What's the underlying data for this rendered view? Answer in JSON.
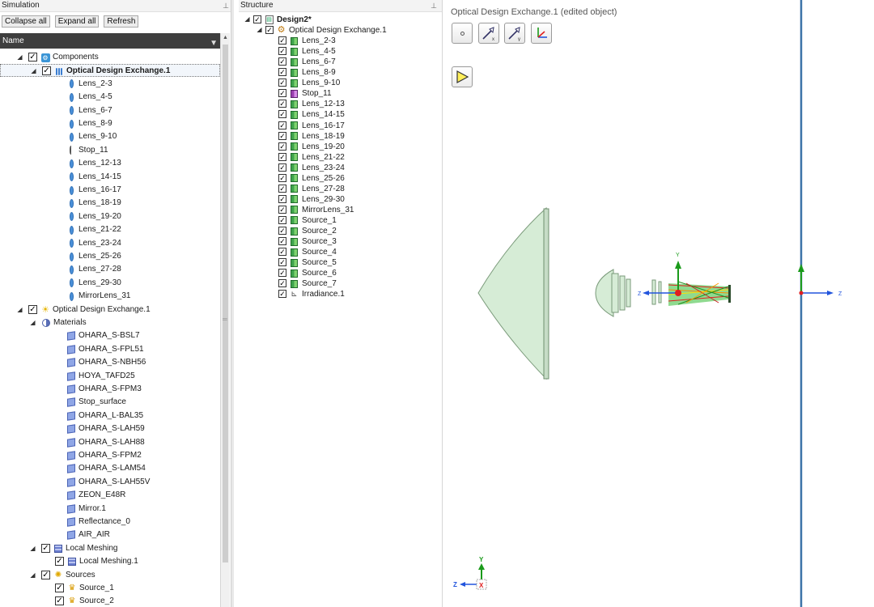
{
  "simulation": {
    "title": "Simulation",
    "toolbar": {
      "collapse_all": "Collapse all",
      "expand_all": "Expand all",
      "refresh": "Refresh"
    },
    "column_header": "Name",
    "tree": [
      {
        "label": "Components",
        "icon": "components-icon",
        "level": 0,
        "expander": "open",
        "checkbox": true
      },
      {
        "label": "Optical Design Exchange.1",
        "icon": "optical-design-exchange-icon",
        "level": 1,
        "expander": "open",
        "checkbox": true,
        "selected": true
      },
      {
        "label": "Lens_2-3",
        "icon": "lens-icon",
        "level": 2
      },
      {
        "label": "Lens_4-5",
        "icon": "lens-icon",
        "level": 2
      },
      {
        "label": "Lens_6-7",
        "icon": "lens-icon",
        "level": 2
      },
      {
        "label": "Lens_8-9",
        "icon": "lens-icon",
        "level": 2
      },
      {
        "label": "Lens_9-10",
        "icon": "lens-icon",
        "level": 2
      },
      {
        "label": "Stop_11",
        "icon": "stop-icon",
        "level": 2
      },
      {
        "label": "Lens_12-13",
        "icon": "lens-icon",
        "level": 2
      },
      {
        "label": "Lens_14-15",
        "icon": "lens-icon",
        "level": 2
      },
      {
        "label": "Lens_16-17",
        "icon": "lens-icon",
        "level": 2
      },
      {
        "label": "Lens_18-19",
        "icon": "lens-icon",
        "level": 2
      },
      {
        "label": "Lens_19-20",
        "icon": "lens-icon",
        "level": 2
      },
      {
        "label": "Lens_21-22",
        "icon": "lens-icon",
        "level": 2
      },
      {
        "label": "Lens_23-24",
        "icon": "lens-icon",
        "level": 2
      },
      {
        "label": "Lens_25-26",
        "icon": "lens-icon",
        "level": 2
      },
      {
        "label": "Lens_27-28",
        "icon": "lens-icon",
        "level": 2
      },
      {
        "label": "Lens_29-30",
        "icon": "lens-icon",
        "level": 2
      },
      {
        "label": "MirrorLens_31",
        "icon": "lens-icon",
        "level": 2
      },
      {
        "label": "Optical Design Exchange.1",
        "icon": "sun-icon",
        "level": 0,
        "expander": "open",
        "checkbox": true
      },
      {
        "label": "Materials",
        "icon": "materials-icon",
        "level": 1,
        "expander": "open"
      },
      {
        "label": "OHARA_S-BSL7",
        "icon": "material-icon",
        "level": 2
      },
      {
        "label": "OHARA_S-FPL51",
        "icon": "material-icon",
        "level": 2
      },
      {
        "label": "OHARA_S-NBH56",
        "icon": "material-icon",
        "level": 2
      },
      {
        "label": "HOYA_TAFD25",
        "icon": "material-icon",
        "level": 2
      },
      {
        "label": "OHARA_S-FPM3",
        "icon": "material-icon",
        "level": 2
      },
      {
        "label": "Stop_surface",
        "icon": "material-icon",
        "level": 2
      },
      {
        "label": "OHARA_L-BAL35",
        "icon": "material-icon",
        "level": 2
      },
      {
        "label": "OHARA_S-LAH59",
        "icon": "material-icon",
        "level": 2
      },
      {
        "label": "OHARA_S-LAH88",
        "icon": "material-icon",
        "level": 2
      },
      {
        "label": "OHARA_S-FPM2",
        "icon": "material-icon",
        "level": 2
      },
      {
        "label": "OHARA_S-LAM54",
        "icon": "material-icon",
        "level": 2
      },
      {
        "label": "OHARA_S-LAH55V",
        "icon": "material-icon",
        "level": 2
      },
      {
        "label": "ZEON_E48R",
        "icon": "material-icon",
        "level": 2
      },
      {
        "label": "Mirror.1",
        "icon": "material-icon",
        "level": 2
      },
      {
        "label": "Reflectance_0",
        "icon": "material-icon",
        "level": 2
      },
      {
        "label": "AIR_AIR",
        "icon": "material-icon",
        "level": 2
      },
      {
        "label": "Local Meshing",
        "icon": "local-meshing-icon",
        "level": 1,
        "expander": "open",
        "checkbox": true
      },
      {
        "label": "Local Meshing.1",
        "icon": "mesh-icon",
        "level": 2,
        "checkbox": true
      },
      {
        "label": "Sources",
        "icon": "sources-icon",
        "level": 1,
        "expander": "open",
        "checkbox": true
      },
      {
        "label": "Source_1",
        "icon": "source-icon",
        "level": 2,
        "checkbox": true
      },
      {
        "label": "Source_2",
        "icon": "source-icon",
        "level": 2,
        "checkbox": true
      }
    ]
  },
  "structure": {
    "title": "Structure",
    "tree": [
      {
        "label": "Design2*",
        "icon": "design-icon",
        "level": 0,
        "expander": "open",
        "checkbox": true,
        "bold": true
      },
      {
        "label": "Optical Design Exchange.1",
        "icon": "gear-icon",
        "level": 1,
        "expander": "open",
        "checkbox": true
      },
      {
        "label": "Lens_2-3",
        "icon": "green-body-icon",
        "level": 2,
        "checkbox": true
      },
      {
        "label": "Lens_4-5",
        "icon": "green-body-icon",
        "level": 2,
        "checkbox": true
      },
      {
        "label": "Lens_6-7",
        "icon": "green-body-icon",
        "level": 2,
        "checkbox": true
      },
      {
        "label": "Lens_8-9",
        "icon": "green-body-icon",
        "level": 2,
        "checkbox": true
      },
      {
        "label": "Lens_9-10",
        "icon": "green-body-icon",
        "level": 2,
        "checkbox": true
      },
      {
        "label": "Stop_11",
        "icon": "purple-body-icon",
        "level": 2,
        "checkbox": true
      },
      {
        "label": "Lens_12-13",
        "icon": "green-body-icon",
        "level": 2,
        "checkbox": true
      },
      {
        "label": "Lens_14-15",
        "icon": "green-body-icon",
        "level": 2,
        "checkbox": true
      },
      {
        "label": "Lens_16-17",
        "icon": "green-body-icon",
        "level": 2,
        "checkbox": true
      },
      {
        "label": "Lens_18-19",
        "icon": "green-body-icon",
        "level": 2,
        "checkbox": true
      },
      {
        "label": "Lens_19-20",
        "icon": "green-body-icon",
        "level": 2,
        "checkbox": true
      },
      {
        "label": "Lens_21-22",
        "icon": "green-body-icon",
        "level": 2,
        "checkbox": true
      },
      {
        "label": "Lens_23-24",
        "icon": "green-body-icon",
        "level": 2,
        "checkbox": true
      },
      {
        "label": "Lens_25-26",
        "icon": "green-body-icon",
        "level": 2,
        "checkbox": true
      },
      {
        "label": "Lens_27-28",
        "icon": "green-body-icon",
        "level": 2,
        "checkbox": true
      },
      {
        "label": "Lens_29-30",
        "icon": "green-body-icon",
        "level": 2,
        "checkbox": true
      },
      {
        "label": "MirrorLens_31",
        "icon": "green-body-icon",
        "level": 2,
        "checkbox": true
      },
      {
        "label": "Source_1",
        "icon": "green-body-icon",
        "level": 2,
        "checkbox": true
      },
      {
        "label": "Source_2",
        "icon": "green-body-icon",
        "level": 2,
        "checkbox": true
      },
      {
        "label": "Source_3",
        "icon": "green-body-icon",
        "level": 2,
        "checkbox": true
      },
      {
        "label": "Source_4",
        "icon": "green-body-icon",
        "level": 2,
        "checkbox": true
      },
      {
        "label": "Source_5",
        "icon": "green-body-icon",
        "level": 2,
        "checkbox": true
      },
      {
        "label": "Source_6",
        "icon": "green-body-icon",
        "level": 2,
        "checkbox": true
      },
      {
        "label": "Source_7",
        "icon": "green-body-icon",
        "level": 2,
        "checkbox": true
      },
      {
        "label": "Irradiance.1",
        "icon": "irradiance-icon",
        "level": 2,
        "checkbox": true
      }
    ]
  },
  "viewport": {
    "title": "Optical Design Exchange.1 (edited object)",
    "play_icon": "play-icon",
    "axis_labels": {
      "y": "Y",
      "z": "Z",
      "x": "X"
    },
    "colors": {
      "lens_fill": "#d6ecd6",
      "lens_edge": "#7a9a7a",
      "plane": "#3c73a8",
      "axis_green": "#1a9a1a",
      "axis_blue": "#2255dd",
      "axis_red": "#e02020"
    }
  }
}
